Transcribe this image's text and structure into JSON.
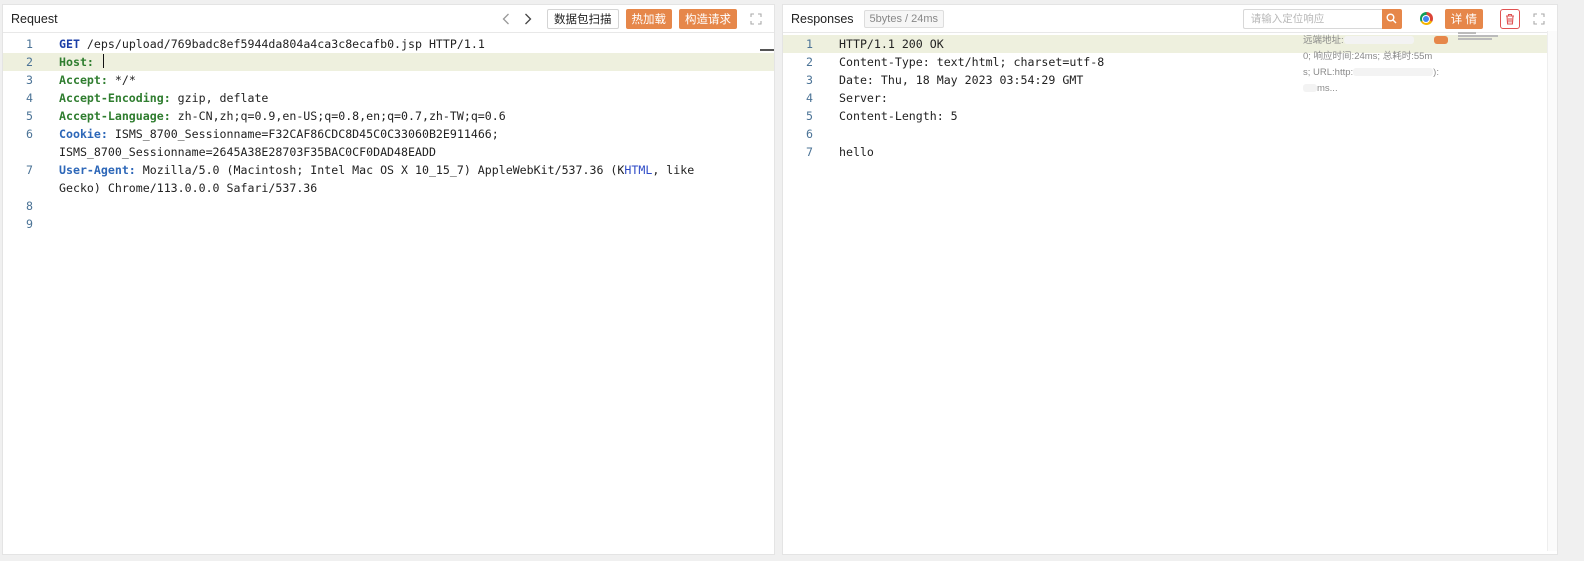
{
  "request": {
    "title": "Request",
    "scan_label": "数据包扫描",
    "hot_load_label": "热加载",
    "build_request_label": "构造请求",
    "lines": [
      {
        "n": "1",
        "method": "GET",
        "rest": " /eps/upload/769badc8ef5944da804a4ca3c8ecafb0.jsp HTTP/1.1"
      },
      {
        "n": "2",
        "key": "Host:",
        "value": " ",
        "highlight": true,
        "cursor": true
      },
      {
        "n": "3",
        "key": "Accept:",
        "value": " */*"
      },
      {
        "n": "4",
        "key": "Accept-Encoding:",
        "value": " gzip, deflate"
      },
      {
        "n": "5",
        "key": "Accept-Language:",
        "value": " zh-CN,zh;q=0.9,en-US;q=0.8,en;q=0.7,zh-TW;q=0.6"
      },
      {
        "n": "6",
        "key": "Cookie:",
        "value": " ISMS_8700_Sessionname=F32CAF86CDC8D45C0C33060B2E911466;\nISMS_8700_Sessionname=2645A38E28703F35BAC0CF0DAD48EADD",
        "blue": true
      },
      {
        "n": "7",
        "key": "User-Agent:",
        "value": " Mozilla/5.0 (Macintosh; Intel Mac OS X 10_15_7) AppleWebKit/537.36 (K",
        "value_html": "HTML",
        "value_tail": ", like\nGecko) Chrome/113.0.0.0 Safari/537.36",
        "blue": true
      },
      {
        "n": "8",
        "value": ""
      },
      {
        "n": "9",
        "value": ""
      }
    ]
  },
  "response": {
    "title": "Responses",
    "size_badge": "5bytes / 24ms",
    "search_placeholder": "请输入定位响应",
    "details_label": "详 情",
    "lines": [
      {
        "n": "1",
        "value": "HTTP/1.1 200 OK",
        "highlight": true
      },
      {
        "n": "2",
        "value": "Content-Type: text/html; charset=utf-8"
      },
      {
        "n": "3",
        "value": "Date: Thu, 18 May 2023 03:54:29 GMT"
      },
      {
        "n": "4",
        "value": "Server:"
      },
      {
        "n": "5",
        "value": "Content-Length: 5"
      },
      {
        "n": "6",
        "value": ""
      },
      {
        "n": "7",
        "value": "hello"
      }
    ],
    "tooltip": {
      "line1": "远端地址:",
      "line2": "0; 响应时间:24ms; 总耗时:55m",
      "line3": "s; URL:http:",
      "line3_tail": "):",
      "line4": "ms..."
    }
  }
}
